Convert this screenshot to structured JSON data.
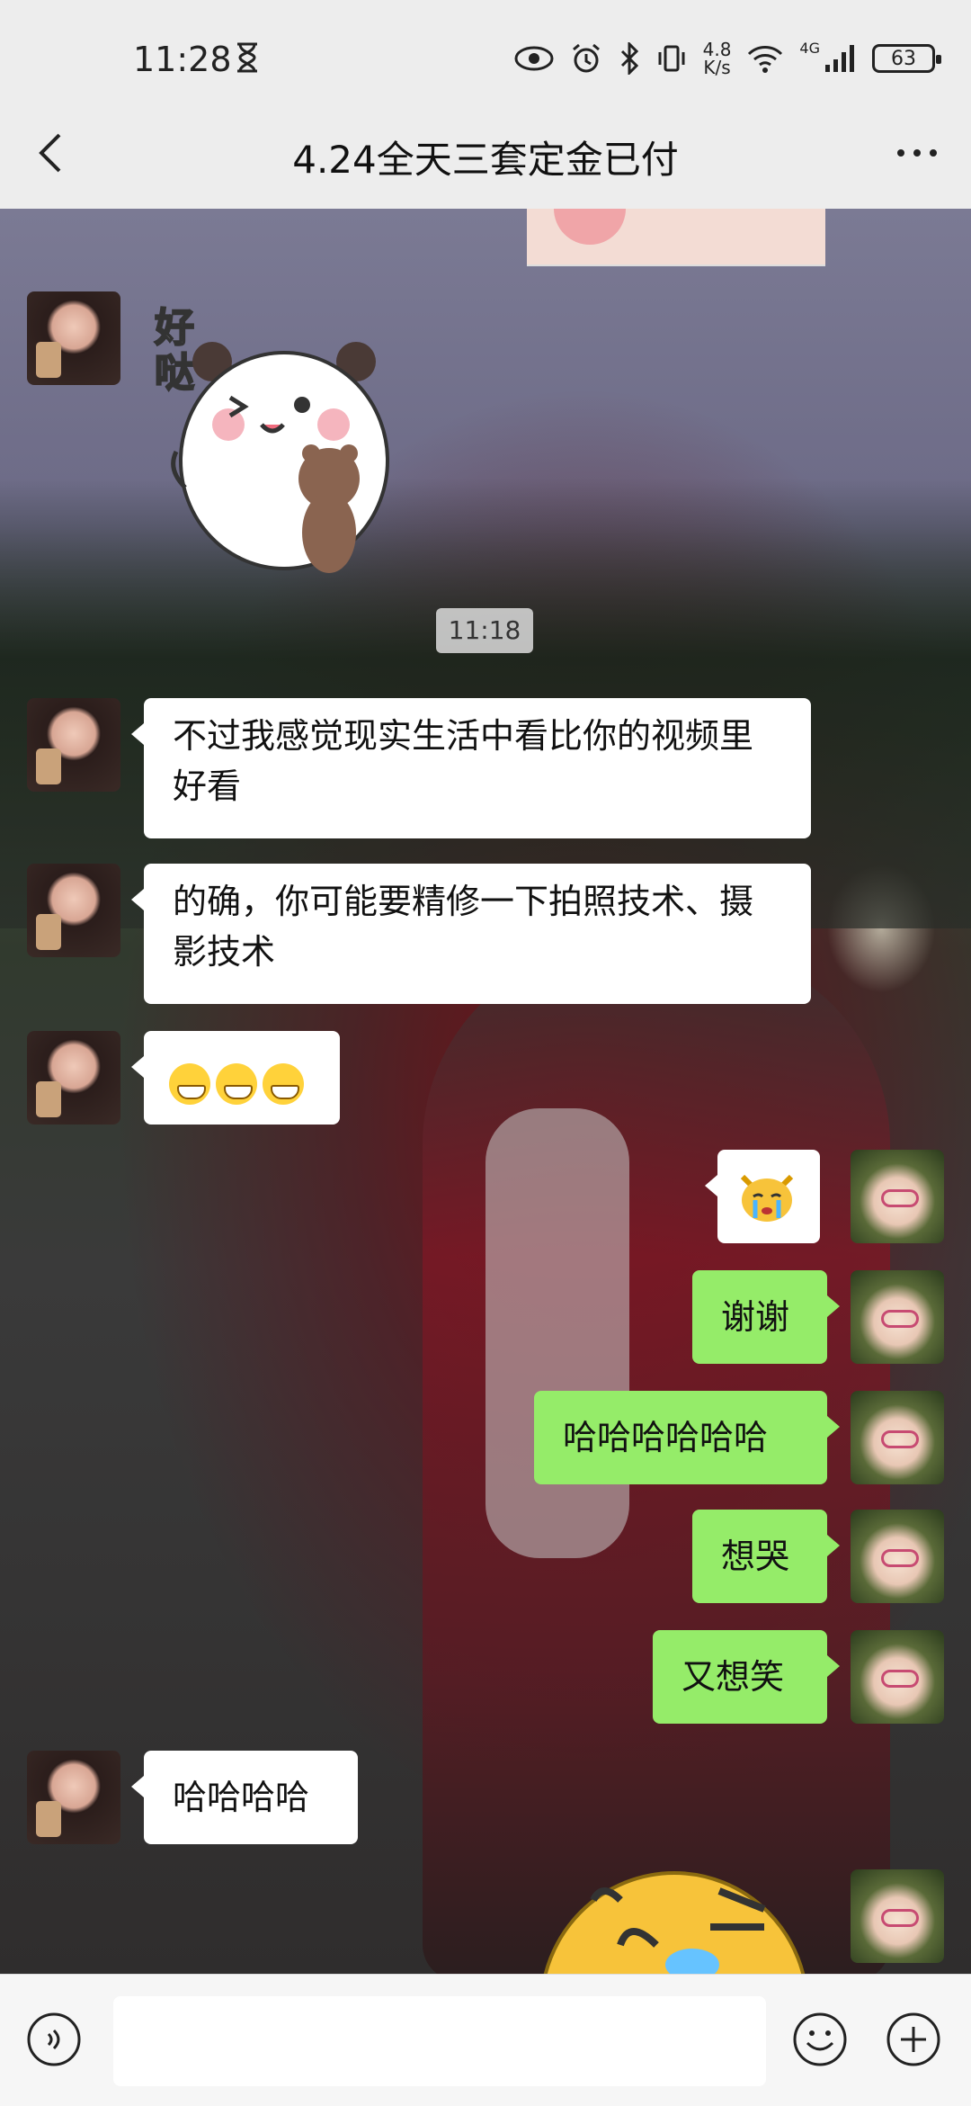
{
  "status_bar": {
    "time": "11:28",
    "net_speed_value": "4.8",
    "net_speed_unit": "K/s",
    "network": "4G",
    "battery": "63"
  },
  "header": {
    "title": "4.24全天三套定金已付"
  },
  "chat": {
    "sticker_text": "好哒",
    "timestamp": "11:18",
    "messages": [
      {
        "side": "in",
        "text": "不过我感觉现实生活中看比你的视频里好看"
      },
      {
        "side": "in",
        "text": "的确，你可能要精修一下拍照技术、摄影技术"
      },
      {
        "side": "in",
        "emoji": "grinning-face x3"
      },
      {
        "side": "out",
        "emoji": "crying-cat"
      },
      {
        "side": "out",
        "text": "谢谢"
      },
      {
        "side": "out",
        "text": "哈哈哈哈哈哈"
      },
      {
        "side": "out",
        "text": "想哭"
      },
      {
        "side": "out",
        "text": "又想笑"
      },
      {
        "side": "in",
        "text": "哈哈哈哈"
      }
    ]
  },
  "input_bar": {
    "value": ""
  },
  "colors": {
    "outgoing_bubble": "#95ec69",
    "incoming_bubble": "#ffffff",
    "bar_bg": "#ededed"
  }
}
